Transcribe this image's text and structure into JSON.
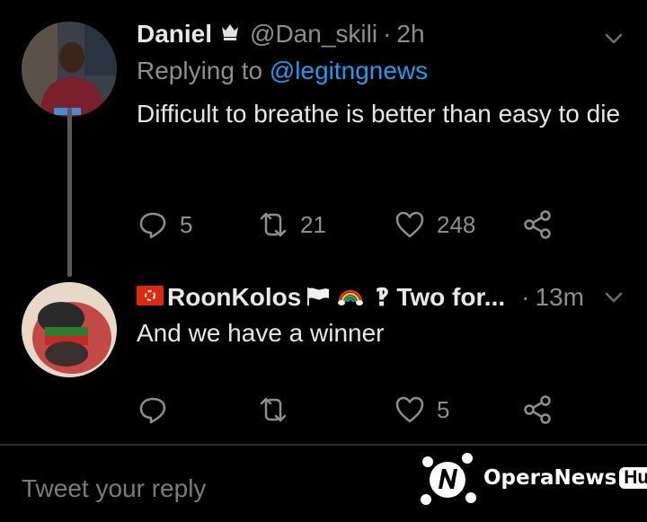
{
  "tweet1": {
    "name": "Daniel",
    "handle": "@Dan_skili",
    "dot": "·",
    "time": "2h",
    "replying_prefix": "Replying to ",
    "replying_mention": "@legitngnews",
    "text": "Difficult to breathe is better than easy to die",
    "reply_count": "5",
    "retweet_count": "21",
    "like_count": "248"
  },
  "tweet2": {
    "name": "RoonKolos",
    "name_suffix": "‽ Two for...",
    "dot": "·",
    "time": "13m",
    "text": "And we have a winner",
    "like_count": "5"
  },
  "compose": {
    "placeholder": "Tweet your reply"
  },
  "watermark": {
    "text": "OperaNews",
    "badge": "Hub"
  },
  "colors": {
    "background": "#000000",
    "mention": "#1d9bf0",
    "muted": "#8e8e8e"
  }
}
